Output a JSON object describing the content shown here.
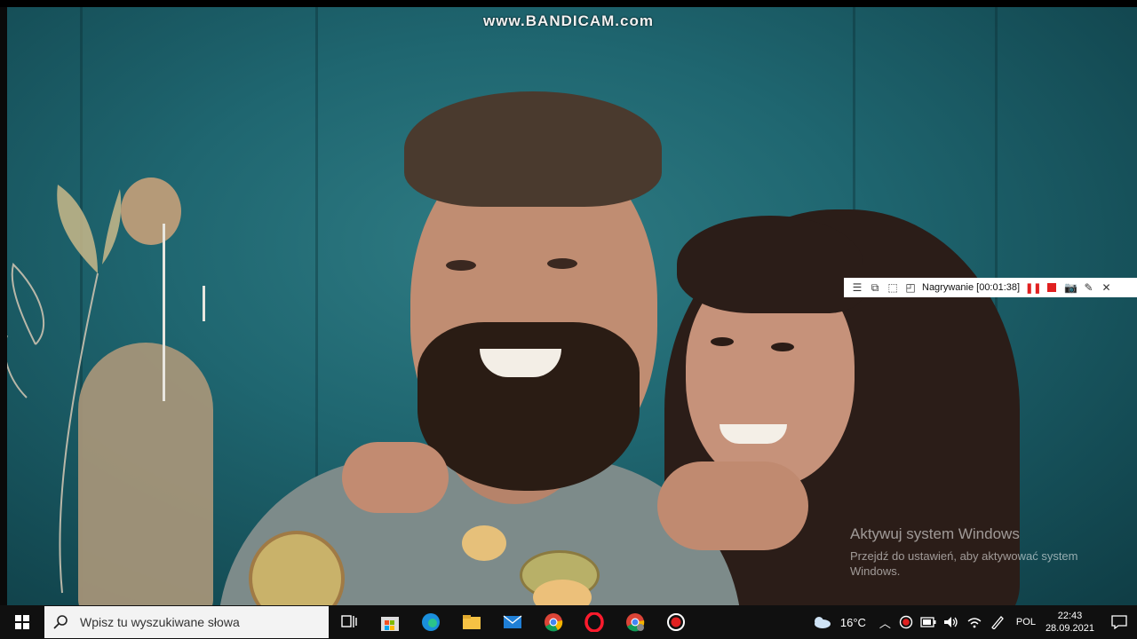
{
  "watermark": {
    "text": "www.BANDICAM.com"
  },
  "bandicam_toolbar": {
    "recording_label": "Nagrywanie [00:01:38]"
  },
  "activation": {
    "title": "Aktywuj system Windows",
    "subtitle": "Przejdź do ustawień, aby aktywować system Windows."
  },
  "taskbar": {
    "search_placeholder": "Wpisz tu wyszukiwane słowa",
    "weather_temp": "16°C",
    "language": "POL",
    "time": "22:43",
    "date": "28.09.2021",
    "apps": [
      "task-view",
      "microsoft-store",
      "edge",
      "file-explorer",
      "mail",
      "chrome",
      "opera",
      "chrome-alt",
      "bandicam"
    ]
  },
  "colors": {
    "accent_red": "#e02020",
    "taskbar_bg": "#101010"
  }
}
